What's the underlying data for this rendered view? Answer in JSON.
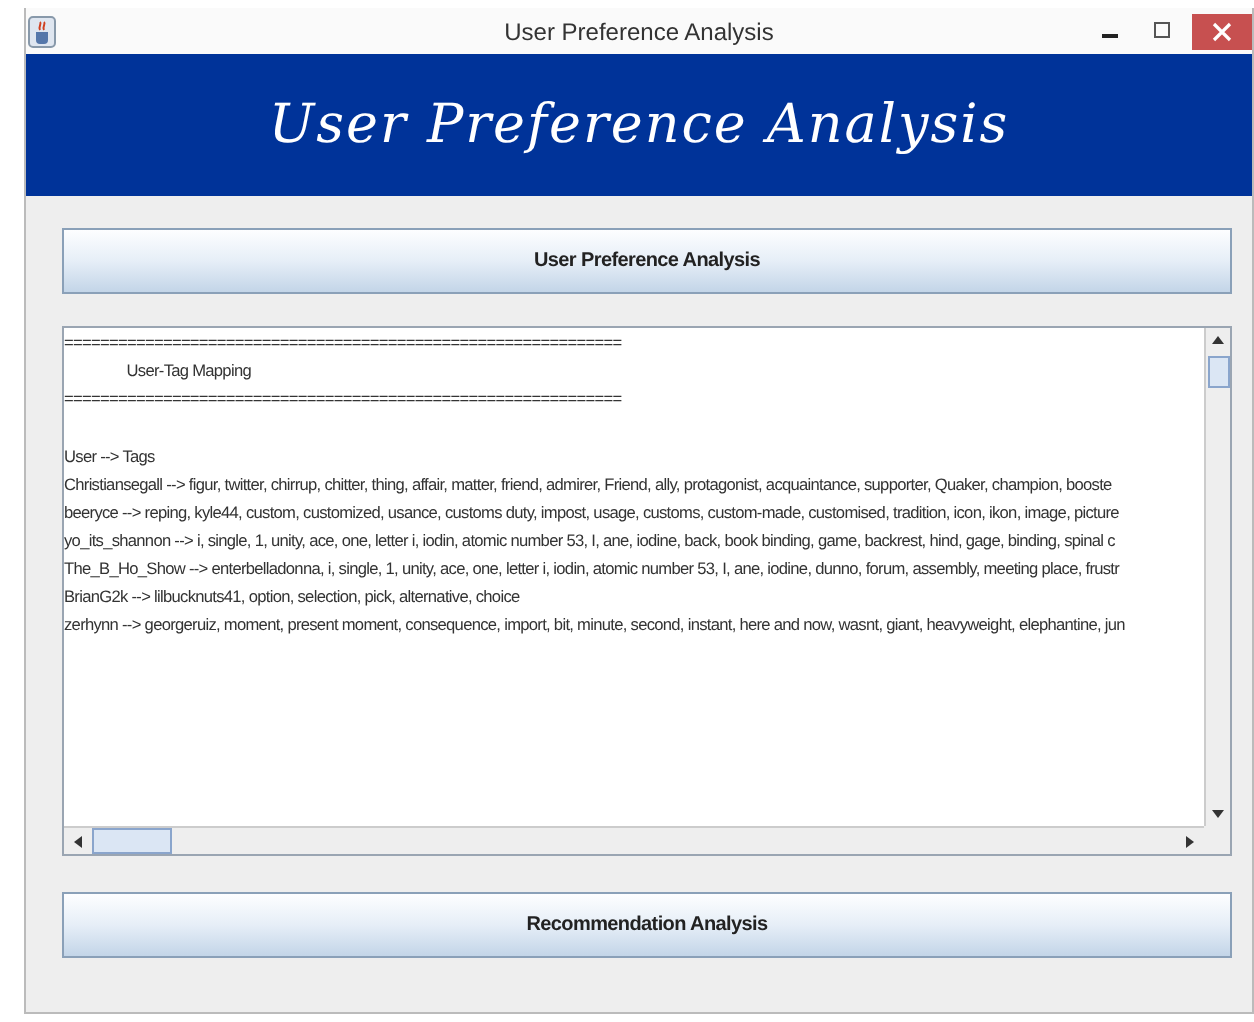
{
  "window": {
    "title": "User Preference Analysis"
  },
  "banner": {
    "title": "User Preference Analysis"
  },
  "buttons": [
    "User Preference Analysis",
    "Recommendation Analysis"
  ],
  "output": {
    "lines": [
      "==============================================================",
      "                User-Tag Mapping",
      "==============================================================",
      "User --> Tags",
      "Christiansegall --> figur, twitter, chirrup, chitter, thing, affair, matter, friend, admirer, Friend, ally, protagonist, acquaintance, supporter, Quaker, champion, booste",
      "beeryce --> reping, kyle44, custom, customized, usance, customs duty, impost, usage, customs, custom-made, customised, tradition, icon, ikon, image, picture",
      "yo_its_shannon --> i, single, 1, unity, ace, one, letter i, iodin, atomic number 53, I, ane, iodine, back, book binding, game, backrest, hind, gage, binding, spinal c",
      "The_B_Ho_Show --> enterbelladonna, i, single, 1, unity, ace, one, letter i, iodin, atomic number 53, I, ane, iodine, dunno, forum, assembly, meeting place, frustr",
      "BrianG2k --> lilbucknuts41, option, selection, pick, alternative, choice",
      "zerhynn --> georgeruiz, moment, present moment, consequence, import, bit, minute, second, instant, here and now, wasnt, giant, heavyweight, elephantine, jun"
    ]
  }
}
